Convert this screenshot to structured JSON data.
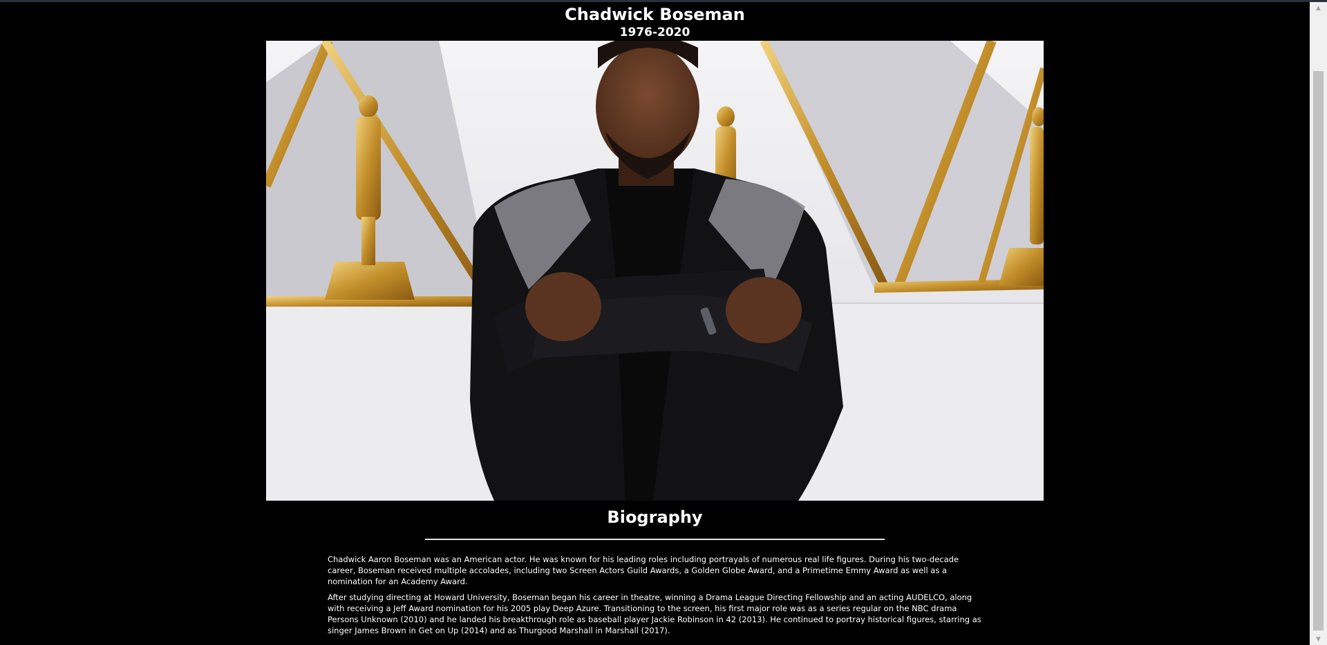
{
  "header": {
    "name": "Chadwick Boseman",
    "years": "1976-2020"
  },
  "photo": {
    "subject": "portrait-photo"
  },
  "biography": {
    "heading": "Biography",
    "paragraphs": [
      "Chadwick Aaron Boseman was an American actor. He was known for his leading roles including portrayals of numerous real life figures. During his two-decade career, Boseman received multiple accolades, including two Screen Actors Guild Awards, a Golden Globe Award, and a Primetime Emmy Award as well as a nomination for an Academy Award.",
      "After studying directing at Howard University, Boseman began his career in theatre, winning a Drama League Directing Fellowship and an acting AUDELCO, along with receiving a Jeff Award nomination for his 2005 play Deep Azure. Transitioning to the screen, his first major role was as a series regular on the NBC drama Persons Unknown (2010) and he landed his breakthrough role as baseball player Jackie Robinson in 42 (2013). He continued to portray historical figures, starring as singer James Brown in Get on Up (2014) and as Thurgood Marshall in Marshall (2017)."
    ]
  },
  "scrollbar": {
    "up_icon": "triangle-up-icon",
    "down_icon": "triangle-down-icon"
  },
  "colors": {
    "background": "#000000",
    "text": "#ffffff",
    "gold": "#c9a24a",
    "wall": "#e9e8ec"
  }
}
